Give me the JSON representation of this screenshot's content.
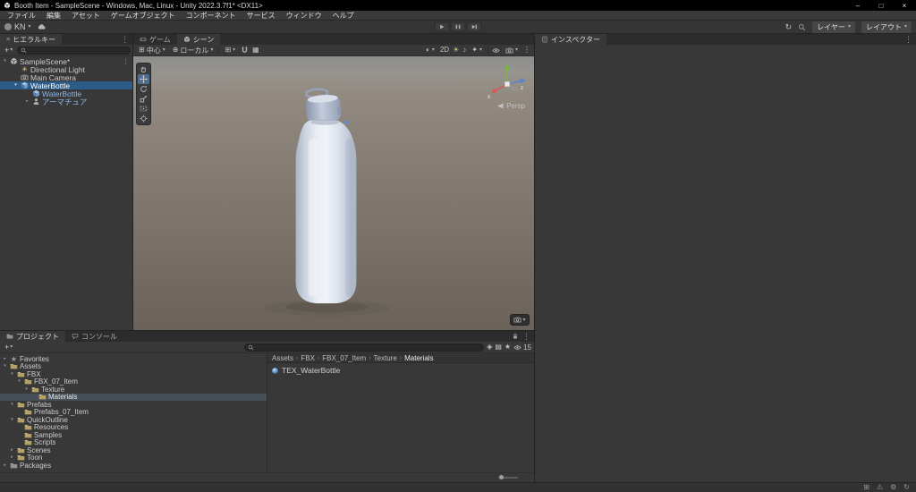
{
  "window": {
    "title": "Booth Item - SampleScene - Windows, Mac, Linux - Unity 2022.3.7f1* <DX11>"
  },
  "menu_bar": {
    "items": [
      "ファイル",
      "編集",
      "アセット",
      "ゲームオブジェクト",
      "コンポーネント",
      "サービス",
      "ウィンドウ",
      "ヘルプ"
    ]
  },
  "toolbar": {
    "account_label": "KN",
    "layers_label": "レイヤー",
    "layout_label": "レイアウト"
  },
  "hierarchy": {
    "tab_label": "ヒエラルキー",
    "rows": [
      {
        "label": "SampleScene*"
      },
      {
        "label": "Directional Light"
      },
      {
        "label": "Main Camera"
      },
      {
        "label": "WaterBottle"
      },
      {
        "label": "WaterBottle"
      },
      {
        "label": "アーマチュア"
      }
    ]
  },
  "scene": {
    "game_tab_label": "ゲーム",
    "scene_tab_label": "シーン",
    "pivot_label": "中心",
    "orientation_label": "ローカル",
    "mode_2d_label": "2D",
    "projection_label": "Persp",
    "axis_x_label": "x",
    "axis_z_label": "z"
  },
  "inspector": {
    "tab_label": "インスペクター"
  },
  "project": {
    "tab_label": "プロジェクト",
    "console_tab_label": "コンソール",
    "favorites_label": "Favorites",
    "hidden_items_count": "15",
    "tree": [
      {
        "label": "Assets"
      },
      {
        "label": "FBX"
      },
      {
        "label": "FBX_07_Item"
      },
      {
        "label": "Texture"
      },
      {
        "label": "Materials"
      },
      {
        "label": "Prefabs"
      },
      {
        "label": "Prefabs_07_Item"
      },
      {
        "label": "QuickOutline"
      },
      {
        "label": "Resources"
      },
      {
        "label": "Samples"
      },
      {
        "label": "Scripts"
      },
      {
        "label": "Scenes"
      },
      {
        "label": "Toon"
      },
      {
        "label": "Packages"
      }
    ],
    "breadcrumbs": [
      "Assets",
      "FBX",
      "FBX_07_Item",
      "Texture",
      "Materials"
    ],
    "items": [
      {
        "label": "TEX_WaterBottle"
      }
    ]
  },
  "icons": {
    "minimize": "–",
    "maximize": "□",
    "close": "×",
    "caret_down": "▾",
    "expander_open": "▾",
    "expander_closed": "▸",
    "menu_dots": "⋮",
    "add": "+",
    "star": "★",
    "crumb_sep": "›",
    "shading_sphere": "◐",
    "light_sun": "☀",
    "audio_note": "♪",
    "effects_star": "✦",
    "grid": "⊞",
    "snap_grid": "▦",
    "orientation_globe": "⊕",
    "refresh": "↻",
    "hierarchy_list": "≡",
    "search_by_label": "▤",
    "search_by_type": "◈",
    "warning": "⚠",
    "gear": "⚙"
  },
  "colors": {
    "selection_active": "#2d5b87",
    "selection_inactive": "#465059",
    "prefab_text": "#8fb6e8",
    "axis_x": "#d25b5b",
    "axis_y": "#72b944",
    "axis_z": "#5a84d6"
  }
}
